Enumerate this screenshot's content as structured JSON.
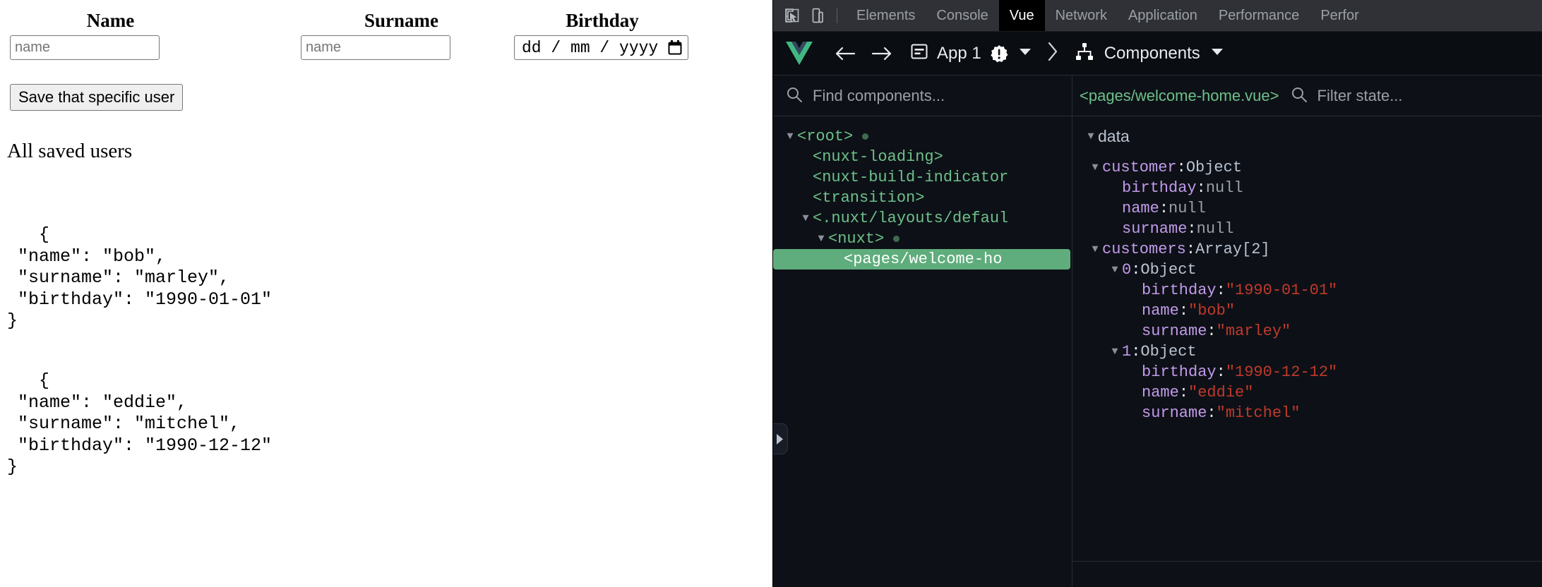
{
  "page": {
    "fields": [
      {
        "label": "Name",
        "placeholder": "name",
        "value": ""
      },
      {
        "label": "Surname",
        "placeholder": "name",
        "value": ""
      },
      {
        "label": "Birthday",
        "placeholder": "dd/mm/yyyy",
        "value": ""
      }
    ],
    "date_display": "dd / mm / yyyy",
    "save_button": "Save that specific user",
    "saved_heading": "All saved users",
    "saved_users_json": [
      "   {\n \"name\": \"bob\",\n \"surname\": \"marley\",\n \"birthday\": \"1990-01-01\"\n}",
      "   {\n \"name\": \"eddie\",\n \"surname\": \"mitchel\",\n \"birthday\": \"1990-12-12\"\n}"
    ]
  },
  "devtools": {
    "tabs": [
      {
        "label": "Elements",
        "active": false
      },
      {
        "label": "Console",
        "active": false
      },
      {
        "label": "Vue",
        "active": true
      },
      {
        "label": "Network",
        "active": false
      },
      {
        "label": "Application",
        "active": false
      },
      {
        "label": "Performance",
        "active": false
      },
      {
        "label": "Perfor",
        "active": false
      }
    ],
    "icons": {
      "inspect": "inspect-element-icon",
      "device": "device-toolbar-icon"
    },
    "vue_header": {
      "app_label": "App 1",
      "panel_label": "Components"
    },
    "search": {
      "components_placeholder": "Find components...",
      "state_placeholder": "Filter state...",
      "selected_file": "<pages/welcome-home.vue>"
    },
    "tree": [
      {
        "label": "<root>",
        "depth": 0,
        "arrow": "down",
        "dot": true,
        "selected": false
      },
      {
        "label": "<nuxt-loading>",
        "depth": 1,
        "arrow": "none",
        "dot": false,
        "selected": false
      },
      {
        "label": "<nuxt-build-indicator",
        "depth": 1,
        "arrow": "none",
        "dot": false,
        "selected": false
      },
      {
        "label": "<transition>",
        "depth": 1,
        "arrow": "none",
        "dot": false,
        "selected": false
      },
      {
        "label": "<.nuxt/layouts/defaul",
        "depth": 1,
        "arrow": "down",
        "dot": false,
        "selected": false
      },
      {
        "label": "<nuxt>",
        "depth": 2,
        "arrow": "down",
        "dot": true,
        "selected": false
      },
      {
        "label": "<pages/welcome-ho",
        "depth": 3,
        "arrow": "none",
        "dot": false,
        "selected": true
      }
    ],
    "state": {
      "section": "data",
      "rows": [
        {
          "depth": 0,
          "arrow": "down",
          "key": "customer",
          "sep": ": ",
          "value": "Object",
          "vtype": "type"
        },
        {
          "depth": 1,
          "arrow": "none",
          "key": "birthday",
          "sep": ": ",
          "value": "null",
          "vtype": "null"
        },
        {
          "depth": 1,
          "arrow": "none",
          "key": "name",
          "sep": ": ",
          "value": "null",
          "vtype": "null"
        },
        {
          "depth": 1,
          "arrow": "none",
          "key": "surname",
          "sep": ": ",
          "value": "null",
          "vtype": "null"
        },
        {
          "depth": 0,
          "arrow": "down",
          "key": "customers",
          "sep": ": ",
          "value": "Array[2]",
          "vtype": "type"
        },
        {
          "depth": 1,
          "arrow": "down",
          "key": "0",
          "sep": ": ",
          "value": "Object",
          "vtype": "type"
        },
        {
          "depth": 2,
          "arrow": "none",
          "key": "birthday",
          "sep": ": ",
          "value": "\"1990-01-01\"",
          "vtype": "str"
        },
        {
          "depth": 2,
          "arrow": "none",
          "key": "name",
          "sep": ": ",
          "value": "\"bob\"",
          "vtype": "str"
        },
        {
          "depth": 2,
          "arrow": "none",
          "key": "surname",
          "sep": ": ",
          "value": "\"marley\"",
          "vtype": "str"
        },
        {
          "depth": 1,
          "arrow": "down",
          "key": "1",
          "sep": ": ",
          "value": "Object",
          "vtype": "type"
        },
        {
          "depth": 2,
          "arrow": "none",
          "key": "birthday",
          "sep": ": ",
          "value": "\"1990-12-12\"",
          "vtype": "str"
        },
        {
          "depth": 2,
          "arrow": "none",
          "key": "name",
          "sep": ": ",
          "value": "\"eddie\"",
          "vtype": "str"
        },
        {
          "depth": 2,
          "arrow": "none",
          "key": "surname",
          "sep": ": ",
          "value": "\"mitchel\"",
          "vtype": "str"
        }
      ]
    },
    "colors": {
      "tab_active_bg": "#000000",
      "tabbar_bg": "#2f3136",
      "panel_bg": "#0d1117",
      "selected_row_bg": "#5fad7c",
      "component_green": "#6ec08a",
      "prop_purple": "#c39aea",
      "string_red": "#c0392b",
      "null_gray": "#9aa0a6"
    }
  }
}
